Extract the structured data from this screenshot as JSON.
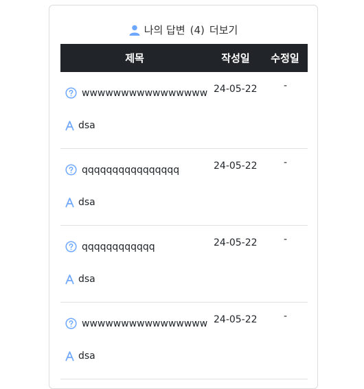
{
  "header": {
    "title": "나의 답변",
    "count": "(4)",
    "more_label": "더보기",
    "icon": "user-icon"
  },
  "table": {
    "columns": [
      "제목",
      "작성일",
      "수정일"
    ],
    "rows": [
      {
        "question": "wwwwwwwwwwwwwwww",
        "answer": "dsa",
        "created": "24-05-22",
        "modified": "-"
      },
      {
        "question": "qqqqqqqqqqqqqqqq",
        "answer": "dsa",
        "created": "24-05-22",
        "modified": "-"
      },
      {
        "question": "qqqqqqqqqqqq",
        "answer": "dsa",
        "created": "24-05-22",
        "modified": "-"
      },
      {
        "question": "wwwwwwwwwwwwwwww",
        "answer": "dsa",
        "created": "24-05-22",
        "modified": "-"
      }
    ]
  },
  "colors": {
    "header_bg": "#212529",
    "icon_blue": "#6ea8fe"
  }
}
